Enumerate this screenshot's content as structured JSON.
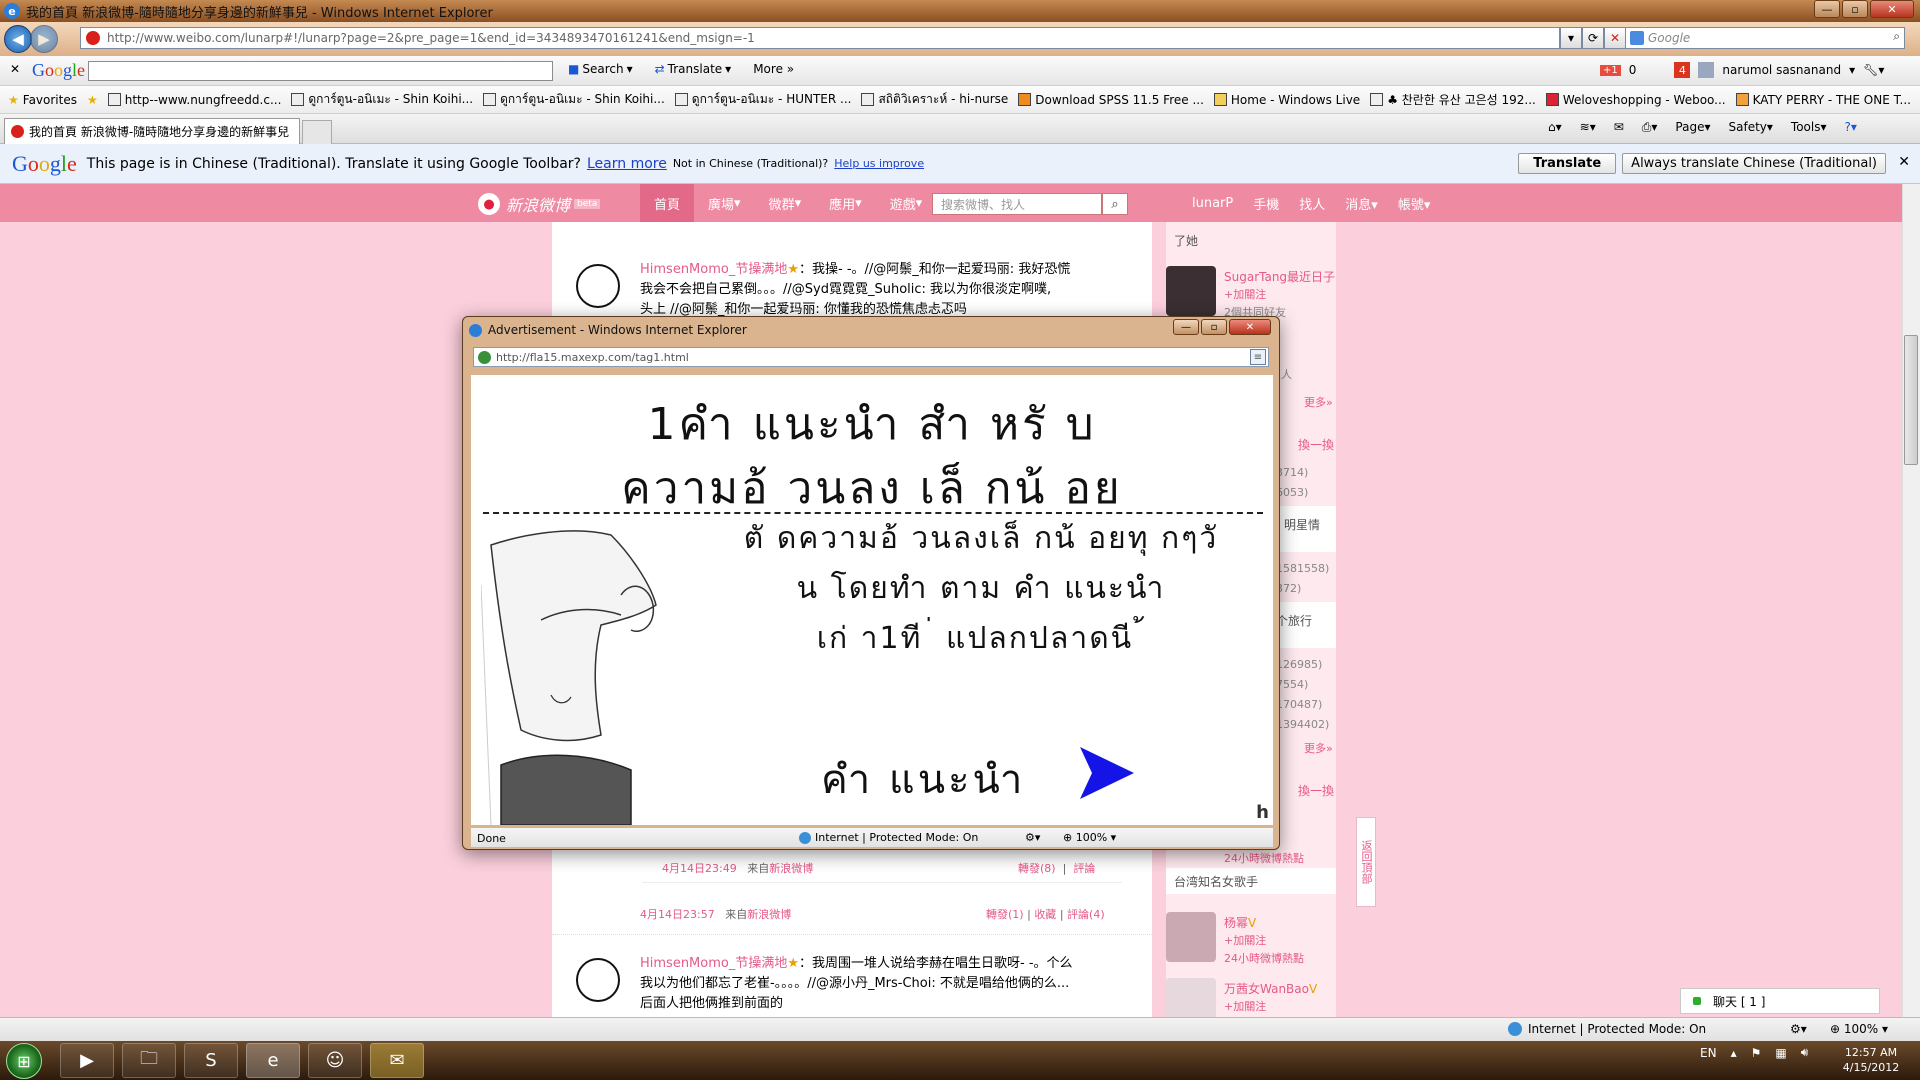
{
  "window": {
    "title": "我的首頁 新浪微博-隨時隨地分享身邊的新鮮事兒 - Windows Internet Explorer"
  },
  "address": {
    "url": "http://www.weibo.com/lunarp#!/lunarp?page=2&pre_page=1&end_id=3434893470161241&end_msign=-1",
    "search_placeholder": "Google"
  },
  "google_toolbar": {
    "logo": "Google",
    "search": "Search",
    "translate": "Translate",
    "more": "More »",
    "count": "0",
    "badge": "4",
    "user": "narumol sasnanand"
  },
  "favorites": {
    "label": "Favorites",
    "items": [
      "http--www.nungfreedd.c...",
      "ดูการ์ตูน-อนิเมะ - Shin Koihi...",
      "ดูการ์ตูน-อนิเมะ - Shin Koihi...",
      "ดูการ์ตูน-อนิเมะ - HUNTER ...",
      "สถิติวิเคราะห์ - hi-nurse",
      "Download SPSS 11.5 Free ...",
      "Home - Windows Live",
      "♣ 찬란한 유산 고은성 192...",
      "Weloveshopping - Weboo...",
      "KATY PERRY - THE ONE T..."
    ]
  },
  "tab": {
    "title": "我的首頁 新浪微博-隨時隨地分享身邊的新鮮事兒"
  },
  "commands": {
    "page": "Page",
    "safety": "Safety",
    "tools": "Tools"
  },
  "translate_bar": {
    "logo": "Google",
    "message": "This page is in Chinese (Traditional).  Translate it using Google Toolbar?",
    "learn_more": "Learn more",
    "not_in": "Not in Chinese (Traditional)?",
    "help": "Help us improve",
    "translate_btn": "Translate",
    "always_btn": "Always translate Chinese (Traditional)"
  },
  "weibo": {
    "logo": "新浪微博",
    "beta": "beta",
    "menu": [
      "首頁",
      "廣場",
      "微群",
      "應用",
      "遊戲"
    ],
    "search_placeholder": "搜索微博、找人",
    "right": [
      "lunarP",
      "手機",
      "找人",
      "消息",
      "帳號"
    ]
  },
  "feed": {
    "post1": {
      "author": "HimsenMomo_节操满地",
      "line1": "我操- -。//@阿鬃_和你一起爱玛丽: 我好恐慌",
      "line2": "我会不会把自己累倒。。。//@Syd霓霓霓_Suholic: 我以为你很淡定啊噗,",
      "line3": "头上 //@阿鬃_和你一起爱玛丽: 你懂我的恐慌焦虑忐忑吗"
    },
    "meta1": {
      "time": "4月14日23:49",
      "from": "来自",
      "source": "新浪微博",
      "repost": "轉發(8)",
      "comment": "評論"
    },
    "meta2": {
      "time": "4月14日23:57",
      "from": "来自",
      "source": "新浪微博",
      "repost": "轉發(1)",
      "fav": "收藏",
      "comment": "評論(4)"
    },
    "post2": {
      "author": "HimsenMomo_节操满地",
      "line1": "我周围一堆人说给李赫在唱生日歌呀- -。个么",
      "line2": "我以为他们都忘了老崔-。。。。//@源小丹_Mrs-Choi: 不就是唱给他俩的么...",
      "line3": "后面人把他俩推到前面的"
    }
  },
  "sidebar": {
    "top_text": "了她",
    "user1": {
      "name": "SugarTang最近日子",
      "follow": "+加關注",
      "sub": "2個共同好友"
    },
    "more1": "更多»",
    "swap1": "換一換",
    "nums1": [
      "3714)",
      "6053)"
    ],
    "tag1": "明星情",
    "nums2": [
      "1581558)",
      "372)"
    ],
    "tag2": "个旅行",
    "nums3": [
      "126985)",
      "7554)",
      "170487)",
      "1394402)"
    ],
    "more2": "更多»",
    "swap2": "換一換",
    "hot1": "24小時微博熱點",
    "label": "台湾知名女歌手",
    "user2": {
      "name": "杨幂",
      "follow": "+加關注",
      "sub": "24小時微博熱點"
    },
    "user3": {
      "name": "万茜女WanBao",
      "follow": "+加關注"
    },
    "partial": "主人"
  },
  "backtop": "返回頂部",
  "chat": "聊天 [ 1 ]",
  "status": {
    "zone": "Internet | Protected Mode: On",
    "zoom": "100%"
  },
  "taskbar": {
    "lang": "EN",
    "time": "12:57 AM",
    "date": "4/15/2012"
  },
  "popup": {
    "title": "Advertisement - Windows Internet Explorer",
    "url": "http://fla15.maxexp.com/tag1.html",
    "headline1": "1คำ  แนะนำ   สำ  หรั  บ",
    "headline2": "ความอ้  วนลง เล็  กน้  อย",
    "body1": "ตั  ดความอ้  วนลงเล็  กน้  อยทุ  กๆวั",
    "body2": "น โดยทำ  ตาม  คำ  แนะนำ",
    "body3": "เก่  า1ที  ่  แปลกปลาดนี  ้",
    "cta": "คำ  แนะนำ",
    "logo": "h",
    "status_done": "Done",
    "status_zone": "Internet | Protected Mode: On",
    "zoom": "100%"
  },
  "colors": {
    "weibo_pink": "#ef8aa3",
    "page_bg": "#fbcfdc",
    "link_pink": "#e55a86",
    "cta_arrow": "#1414e6"
  }
}
